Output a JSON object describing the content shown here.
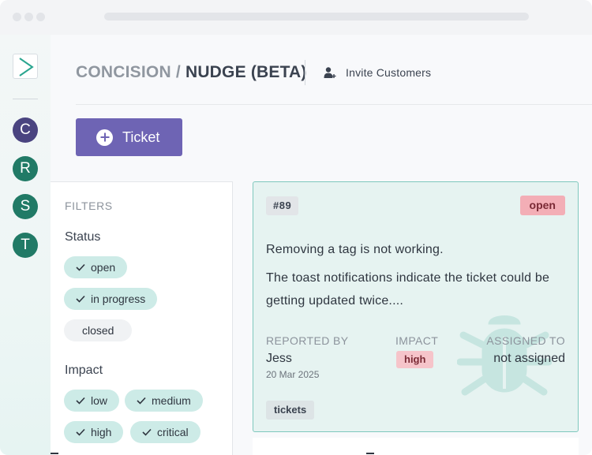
{
  "app": {
    "breadcrumb_org": "CONCISION",
    "breadcrumb_sep": "/",
    "breadcrumb_project": "NUDGE (BETA)",
    "invite_label": "Invite Customers"
  },
  "sidebar": {
    "avatars": [
      {
        "letter": "C",
        "color": "#4a4480"
      },
      {
        "letter": "R",
        "color": "#217a66"
      },
      {
        "letter": "S",
        "color": "#217a66"
      },
      {
        "letter": "T",
        "color": "#217a66"
      }
    ]
  },
  "actions": {
    "new_ticket_label": "Ticket"
  },
  "filters": {
    "title": "FILTERS",
    "status": {
      "label": "Status",
      "options": [
        {
          "label": "open",
          "checked": true
        },
        {
          "label": "in progress",
          "checked": true
        },
        {
          "label": "closed",
          "checked": false
        }
      ]
    },
    "impact": {
      "label": "Impact",
      "options": [
        {
          "label": "low",
          "checked": true
        },
        {
          "label": "medium",
          "checked": true
        },
        {
          "label": "high",
          "checked": true
        },
        {
          "label": "critical",
          "checked": true
        }
      ]
    }
  },
  "ticket": {
    "number": "#89",
    "status": "open",
    "title": "Removing a tag is not working.",
    "description": "The toast notifications indicate the ticket could be getting updated twice....",
    "reported_by_label": "REPORTED BY",
    "reporter": "Jess",
    "date": "20 Mar 2025",
    "impact_label": "IMPACT",
    "impact": "high",
    "assigned_to_label": "ASSIGNED TO",
    "assignee": "not assigned",
    "tag": "tickets"
  },
  "colors": {
    "accent": "#6e64b4",
    "teal": "#217a66",
    "chip_on": "#cdebe7",
    "badge_red": "#f3aeb6"
  }
}
